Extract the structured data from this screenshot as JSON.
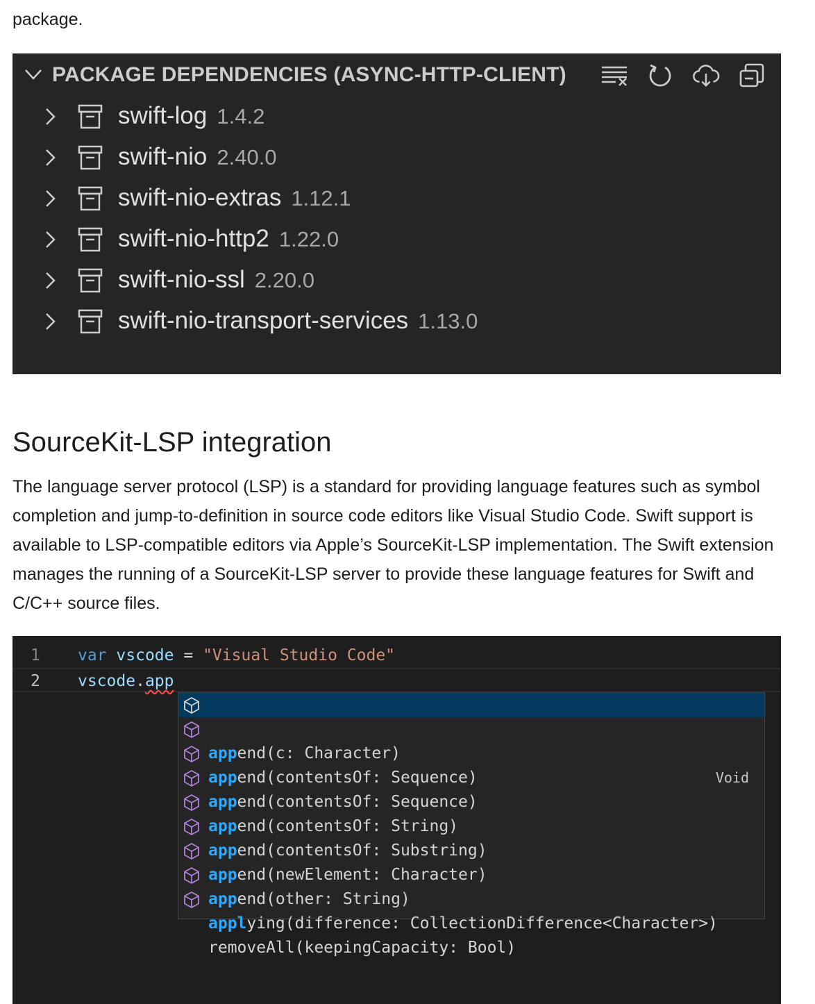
{
  "intro_text": "package.",
  "panel": {
    "title": "PACKAGE DEPENDENCIES (ASYNC-HTTP-CLIENT)",
    "actions": [
      "clear-all-icon",
      "refresh-icon",
      "cloud-download-icon",
      "collapse-all-icon"
    ],
    "dependencies": [
      {
        "name": "swift-log",
        "version": "1.4.2"
      },
      {
        "name": "swift-nio",
        "version": "2.40.0"
      },
      {
        "name": "swift-nio-extras",
        "version": "1.12.1"
      },
      {
        "name": "swift-nio-http2",
        "version": "1.22.0"
      },
      {
        "name": "swift-nio-ssl",
        "version": "2.20.0"
      },
      {
        "name": "swift-nio-transport-services",
        "version": "1.13.0"
      }
    ]
  },
  "section": {
    "heading": "SourceKit-LSP integration",
    "paragraph": "The language server protocol (LSP) is a standard for providing language features such as symbol completion and jump-to-definition in source code editors like Visual Studio Code. Swift support is available to LSP-compatible editors via Apple’s SourceKit-LSP implementation. The Swift extension manages the running of a SourceKit-LSP server to provide these language features for Swift and C/C++ source files."
  },
  "editor": {
    "lines": [
      {
        "number": "1",
        "keyword": "var",
        "identifier": "vscode",
        "operator": "=",
        "string": "\"Visual Studio Code\""
      },
      {
        "number": "2",
        "object": "vscode",
        "dot": ".",
        "member": "app"
      }
    ],
    "suggestions": [
      {
        "pre": "",
        "match": "app",
        "post": "end(c: Character)",
        "detail": "Void",
        "selected": true
      },
      {
        "pre": "",
        "match": "app",
        "post": "end(contentsOf: Sequence)"
      },
      {
        "pre": "",
        "match": "app",
        "post": "end(contentsOf: Sequence)"
      },
      {
        "pre": "",
        "match": "app",
        "post": "end(contentsOf: String)"
      },
      {
        "pre": "",
        "match": "app",
        "post": "end(contentsOf: Substring)"
      },
      {
        "pre": "",
        "match": "app",
        "post": "end(newElement: Character)"
      },
      {
        "pre": "",
        "match": "app",
        "post": "end(other: String)"
      },
      {
        "pre": "",
        "match": "appl",
        "post": "ying(difference: CollectionDifference<Character>)"
      },
      {
        "pre": "removeAll(keepingCapacity: Bool)"
      }
    ]
  }
}
